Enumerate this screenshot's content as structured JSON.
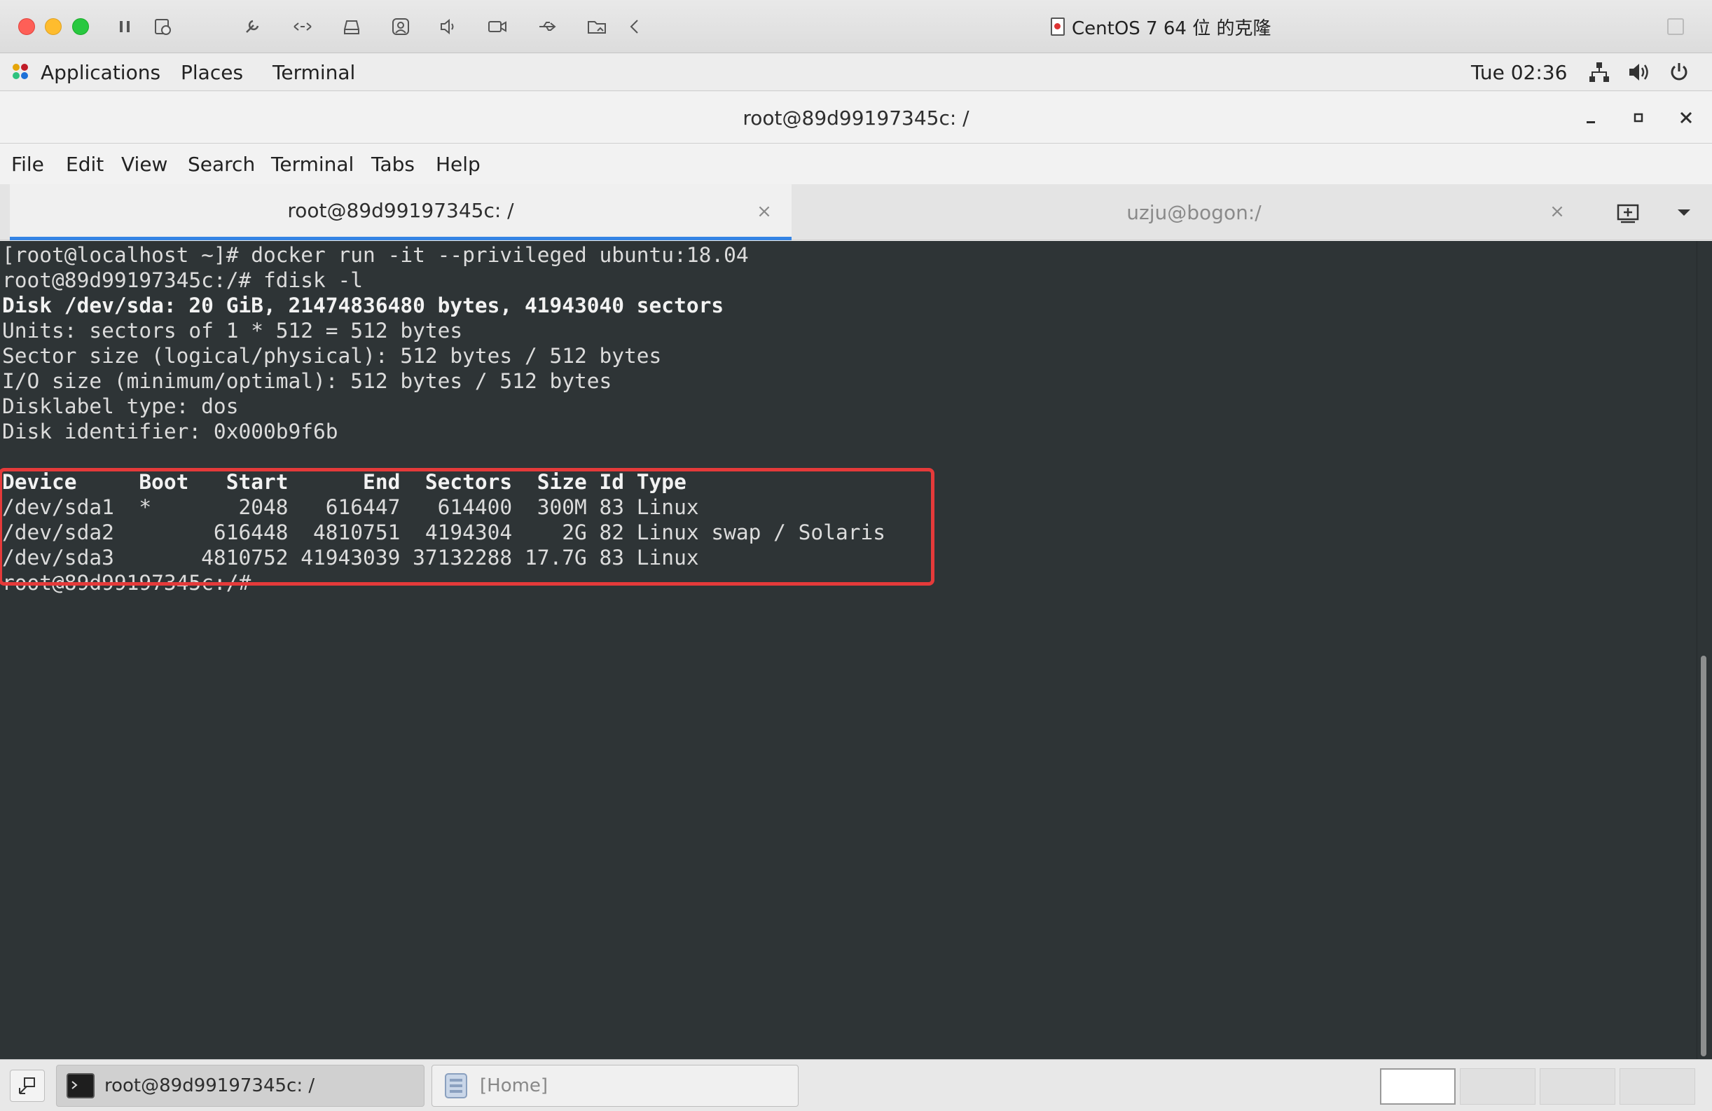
{
  "vm_window": {
    "title": "CentOS 7 64 位 的克隆",
    "toolbar_icons": [
      "pause-icon",
      "snapshot-icon",
      "settings-wrench-icon",
      "network-arrows-icon",
      "disk-icon",
      "user-icon",
      "sound-icon",
      "camera-icon",
      "usb-icon",
      "folder-icon",
      "back-chevron-icon"
    ]
  },
  "gnome_top_bar": {
    "applications_label": "Applications",
    "places_label": "Places",
    "terminal_label": "Terminal",
    "clock": "Tue 02:36"
  },
  "terminal_window": {
    "title": "root@89d99197345c: /",
    "menu": [
      "File",
      "Edit",
      "View",
      "Search",
      "Terminal",
      "Tabs",
      "Help"
    ],
    "tabs": [
      {
        "label": "root@89d99197345c: /",
        "active": true
      },
      {
        "label": "uzju@bogon:/",
        "active": false
      }
    ],
    "tab_close_glyph": "×",
    "lines": [
      {
        "text": "[root@localhost ~]# docker run -it --privileged ubuntu:18.04",
        "bold": false
      },
      {
        "text": "root@89d99197345c:/# fdisk -l",
        "bold": false
      },
      {
        "text": "Disk /dev/sda: 20 GiB, 21474836480 bytes, 41943040 sectors",
        "bold": true
      },
      {
        "text": "Units: sectors of 1 * 512 = 512 bytes",
        "bold": false
      },
      {
        "text": "Sector size (logical/physical): 512 bytes / 512 bytes",
        "bold": false
      },
      {
        "text": "I/O size (minimum/optimal): 512 bytes / 512 bytes",
        "bold": false
      },
      {
        "text": "Disklabel type: dos",
        "bold": false
      },
      {
        "text": "Disk identifier: 0x000b9f6b",
        "bold": false
      },
      {
        "text": "",
        "bold": false
      },
      {
        "text": "Device     Boot   Start      End  Sectors  Size Id Type",
        "bold": true
      },
      {
        "text": "/dev/sda1  *       2048   616447   614400  300M 83 Linux",
        "bold": false
      },
      {
        "text": "/dev/sda2        616448  4810751  4194304    2G 82 Linux swap / Solaris",
        "bold": false
      },
      {
        "text": "/dev/sda3       4810752 41943039 37132288 17.7G 83 Linux",
        "bold": false
      },
      {
        "text": "root@89d99197345c:/# ",
        "bold": false
      }
    ]
  },
  "bottom_panel": {
    "tasks": [
      {
        "label": "root@89d99197345c: /",
        "active": true,
        "icon": "terminal-icon"
      },
      {
        "label": "[Home]",
        "active": false,
        "icon": "file-manager-icon"
      }
    ],
    "workspaces": 4
  },
  "colors": {
    "terminal_bg": "#2e3436",
    "terminal_fg": "#dcdcdc",
    "highlight": "#e53a3a",
    "tab_accent": "#3584e4"
  }
}
